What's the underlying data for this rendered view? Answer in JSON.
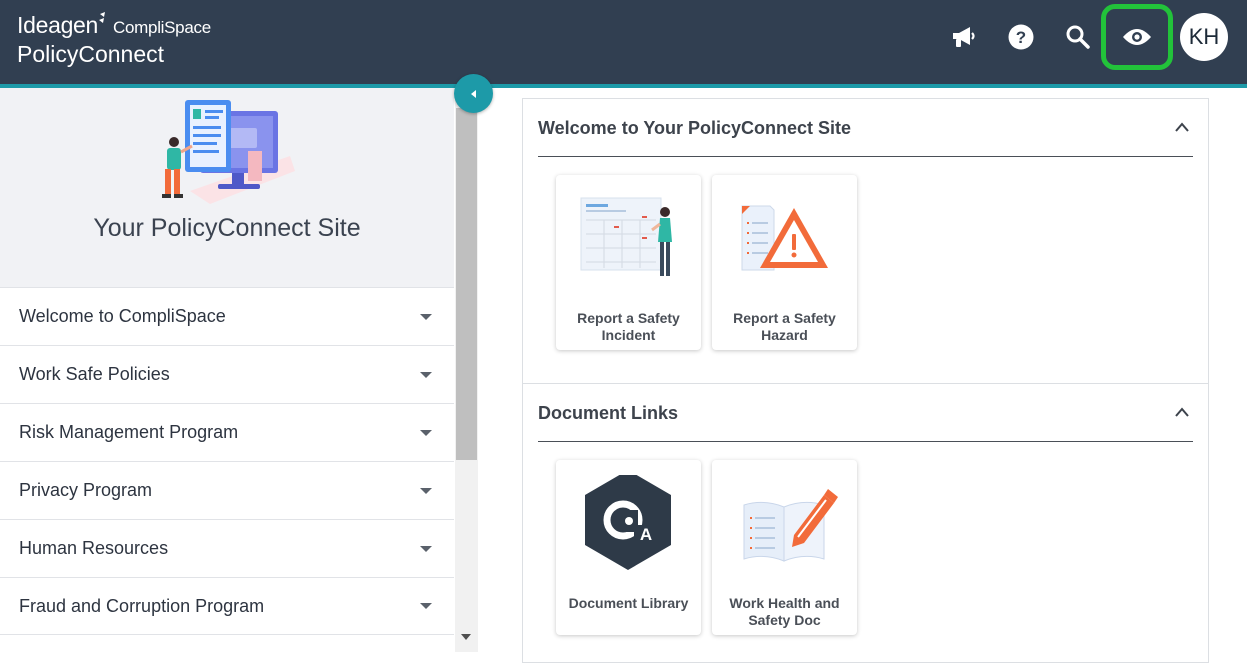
{
  "header": {
    "brand_top": "Ideagen",
    "brand_sub": "CompliSpace",
    "brand_bottom": "PolicyConnect",
    "icons": [
      "megaphone-icon",
      "help-icon",
      "search-icon",
      "eye-icon"
    ],
    "avatar_initials": "KH",
    "colors": {
      "bar": "#313f51",
      "stripe": "#1d9aa8",
      "highlight": "#22c23a"
    }
  },
  "sidebar": {
    "site_title": "Your PolicyConnect Site",
    "items": [
      {
        "label": "Welcome to CompliSpace"
      },
      {
        "label": "Work Safe Policies"
      },
      {
        "label": "Risk Management Program"
      },
      {
        "label": "Privacy Program"
      },
      {
        "label": "Human Resources"
      },
      {
        "label": "Fraud and Corruption Program"
      }
    ]
  },
  "main": {
    "panels": [
      {
        "title": "Welcome to Your PolicyConnect Site",
        "tiles": [
          {
            "label": "Report a Safety Incident",
            "icon": "safety-incident-icon"
          },
          {
            "label": "Report a Safety Hazard",
            "icon": "warning-icon"
          }
        ]
      },
      {
        "title": "Document Links",
        "tiles": [
          {
            "label": "Document Library",
            "icon": "document-library-icon"
          },
          {
            "label": "Work Health and Safety Doc",
            "icon": "book-pencil-icon"
          }
        ]
      }
    ]
  }
}
